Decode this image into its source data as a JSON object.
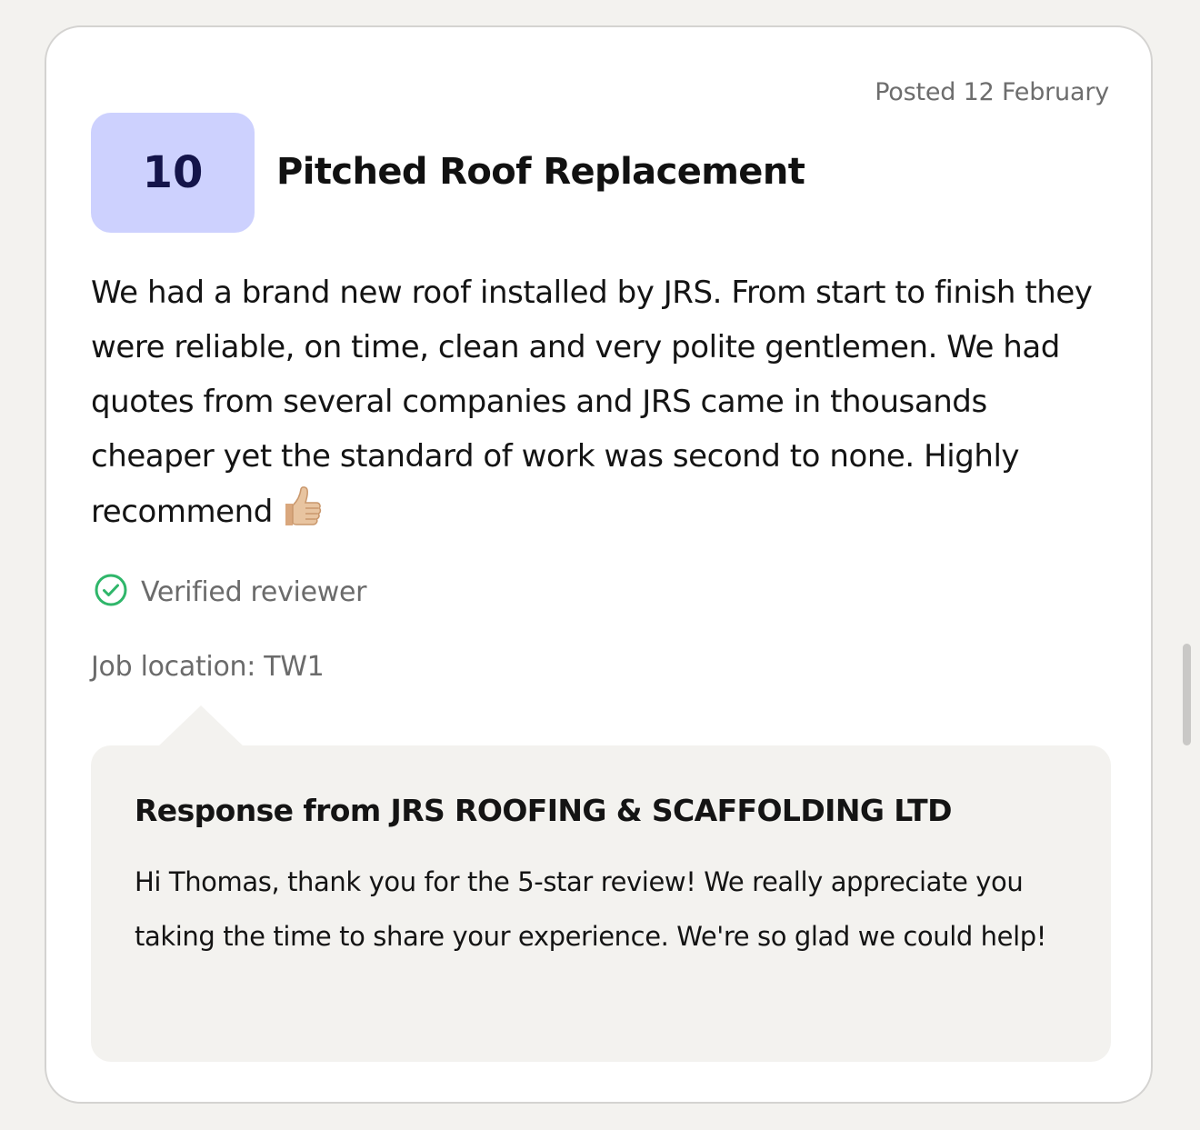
{
  "review": {
    "posted": "Posted 12 February",
    "score": "10",
    "title": "Pitched Roof Replacement",
    "body": "We had a brand new roof installed by JRS. From start to finish they were reliable, on time, clean and very polite gentlemen. We had quotes from several companies and JRS came in thousands cheaper yet the standard of work was second to none. Highly recommend",
    "body_emoji": "thumbs-up-icon",
    "verified_label": "Verified reviewer",
    "verified_icon": "check-circle-icon",
    "job_location": "Job location: TW1"
  },
  "response": {
    "title": "Response from JRS ROOFING & SCAFFOLDING LTD",
    "text": "Hi Thomas, thank you for the 5-star review! We really appreciate you taking the time to share your experience. We're so glad we could help!"
  },
  "colors": {
    "score_bg": "#cdd1fe",
    "score_text": "#14144a",
    "verified_green": "#2fb66a",
    "response_bg": "#f3f2ef",
    "card_border": "#d4d3d1"
  }
}
